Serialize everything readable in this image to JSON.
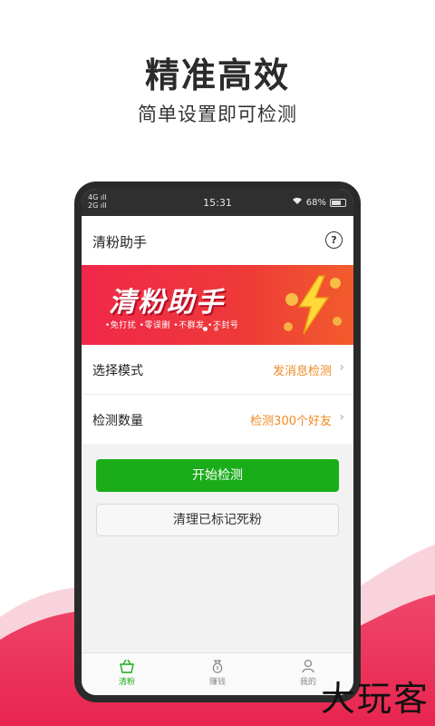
{
  "promo": {
    "headline": "精准高效",
    "subline": "简单设置即可检测"
  },
  "status_bar": {
    "network_top": "4G",
    "network_bottom": "2G",
    "time": "15:31",
    "battery": "68%"
  },
  "app": {
    "title": "清粉助手"
  },
  "banner": {
    "title": "清粉助手",
    "tagline": "•免打扰 •零误删 •不群发 •不封号"
  },
  "settings": [
    {
      "label": "选择模式",
      "value": "发消息检测"
    },
    {
      "label": "检测数量",
      "value": "检测300个好友"
    }
  ],
  "actions": {
    "start": "开始检测",
    "clear": "清理已标记死粉"
  },
  "tabs": [
    {
      "label": "清粉",
      "icon": "basket-icon",
      "active": true
    },
    {
      "label": "赚钱",
      "icon": "money-bag-icon",
      "active": false
    },
    {
      "label": "我的",
      "icon": "person-icon",
      "active": false
    }
  ],
  "watermark": "大玩客",
  "colors": {
    "accent_green": "#1aad19",
    "value_orange": "#ef8a22",
    "banner_red": "#f0284a"
  }
}
